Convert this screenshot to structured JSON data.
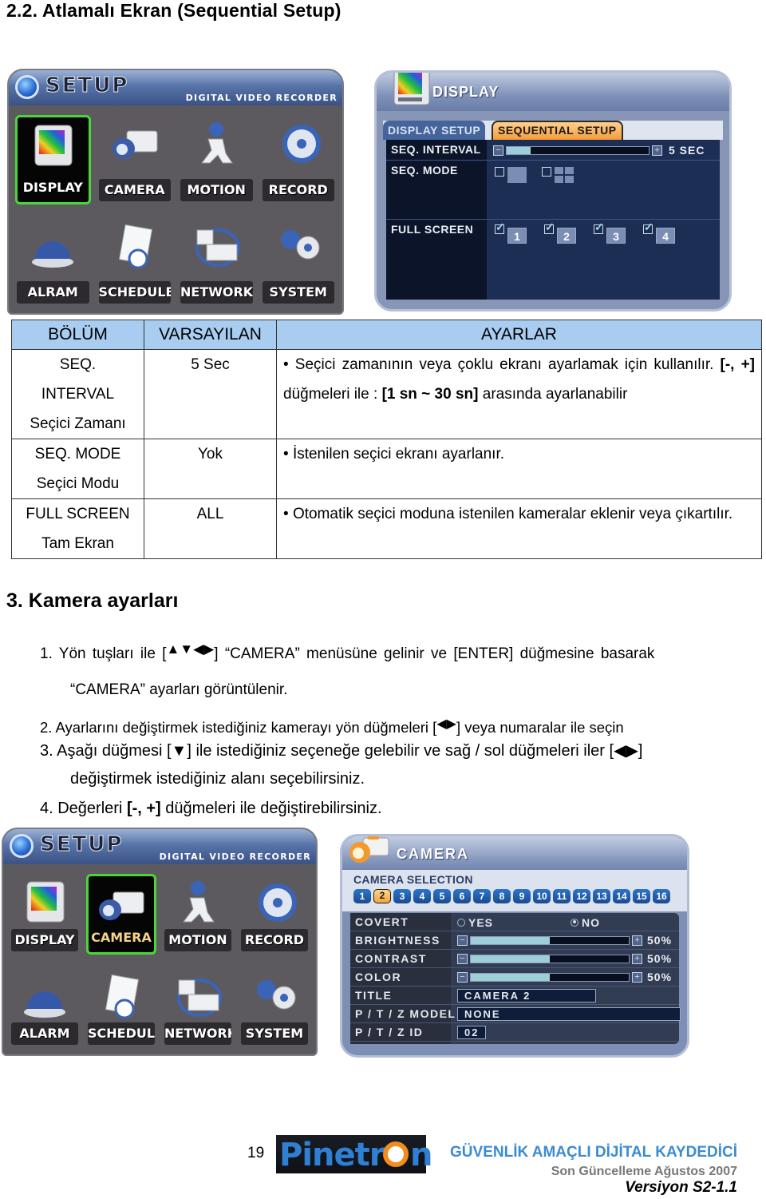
{
  "heading_section": "2.2. Atlamalı Ekran (Sequential Setup)",
  "setup_menu_1": {
    "title": "SETUP",
    "subtitle": "DIGITAL VIDEO RECORDER",
    "items": [
      {
        "label": "DISPLAY",
        "icon": "display-icon",
        "selected": true
      },
      {
        "label": "CAMERA",
        "icon": "camera-icon",
        "selected": false
      },
      {
        "label": "MOTION",
        "icon": "motion-icon",
        "selected": false
      },
      {
        "label": "RECORD",
        "icon": "record-icon",
        "selected": false
      },
      {
        "label": "ALRAM",
        "icon": "alarm-icon",
        "selected": false
      },
      {
        "label": "SCHEDULE",
        "icon": "schedule-icon",
        "selected": false
      },
      {
        "label": "NETWORK",
        "icon": "network-icon",
        "selected": false
      },
      {
        "label": "SYSTEM",
        "icon": "system-icon",
        "selected": false
      }
    ]
  },
  "display_panel": {
    "title": "DISPLAY",
    "tabs": [
      {
        "label": "DISPLAY SETUP",
        "active": false
      },
      {
        "label": "SEQUENTIAL SETUP",
        "active": true
      }
    ],
    "rows": {
      "seq_interval": {
        "label": "SEQ. INTERVAL",
        "value": "5 SEC",
        "fill_fraction": 0.17,
        "minus": "−",
        "plus": "+"
      },
      "seq_mode": {
        "label": "SEQ. MODE",
        "options": [
          {
            "type": "single",
            "checked": false
          },
          {
            "type": "quad",
            "checked": false
          }
        ]
      },
      "full_screen": {
        "label": "FULL SCREEN",
        "cameras": [
          {
            "num": "1",
            "checked": true
          },
          {
            "num": "2",
            "checked": true
          },
          {
            "num": "3",
            "checked": true
          },
          {
            "num": "4",
            "checked": true
          }
        ]
      }
    }
  },
  "table": {
    "headers": [
      "BÖLÜM",
      "VARSAYILAN",
      "AYARLAR"
    ],
    "rows": [
      {
        "section": [
          "SEQ.",
          "INTERVAL",
          "Seçici Zamanı"
        ],
        "default": "5 Sec",
        "desc_parts": [
          "Seçici zamanının veya çoklu ekranı ayarlamak için kullanılır. ",
          "[-, +]",
          " düğmeleri ile : ",
          "[1 sn ~ 30 sn]",
          " arasında ayarlanabilir"
        ]
      },
      {
        "section": [
          "SEQ. MODE",
          "Seçici Modu"
        ],
        "default": "Yok",
        "desc": "İstenilen seçici ekranı ayarlanır."
      },
      {
        "section": [
          "FULL SCREEN",
          "Tam Ekran"
        ],
        "default": "ALL",
        "desc": "Otomatik seçici moduna istenilen kameralar eklenir veya çıkartılır."
      }
    ]
  },
  "heading_camera": "3. Kamera ayarları",
  "steps": {
    "s1a_pre": "1.  Yön  tuşları  ile  [",
    "s1a_arrows": "▲▼◀▶",
    "s1a_post": "]  “CAMERA”  menüsüne  gelinir  ve  [ENTER]  düğmesine  basarak",
    "s1b": "“CAMERA” ayarları görüntülenir.",
    "s2_pre": "2. Ayarlarını değiştirmek istediğiniz kamerayı yön düğmeleri [",
    "s2_arrows": "◀▶",
    "s2_post": "] veya numaralar ile seçin",
    "s3a_pre": "3. Aşağı düğmesi [",
    "s3a_down": "▼",
    "s3a_mid": "] ile istediğiniz seçeneğe gelebilir ve sağ / sol düğmeleri iler [",
    "s3a_lr": "◀▶",
    "s3a_post": "]",
    "s3b": "değiştirmek istediğiniz alanı seçebilirsiniz.",
    "s4_pre": "4. Değerleri ",
    "s4_bold": "[-, +]",
    "s4_post": " düğmeleri ile değiştirebilirsiniz."
  },
  "setup_menu_2": {
    "title": "SETUP",
    "subtitle": "DIGITAL VIDEO RECORDER",
    "items": [
      {
        "label": "DISPLAY",
        "selected": false
      },
      {
        "label": "CAMERA",
        "selected": true
      },
      {
        "label": "MOTION",
        "selected": false
      },
      {
        "label": "RECORD",
        "selected": false
      },
      {
        "label": "ALARM",
        "selected": false
      },
      {
        "label": "SCHEDULE",
        "selected": false
      },
      {
        "label": "NETWORK",
        "selected": false
      },
      {
        "label": "SYSTEM",
        "selected": false
      }
    ]
  },
  "camera_panel": {
    "title": "CAMERA",
    "selection_label": "CAMERA SELECTION",
    "cameras": [
      "1",
      "2",
      "3",
      "4",
      "5",
      "6",
      "7",
      "8",
      "9",
      "10",
      "11",
      "12",
      "13",
      "14",
      "15",
      "16"
    ],
    "selected_camera": "2",
    "rows": {
      "covert": {
        "label": "COVERT",
        "yes": "YES",
        "no": "NO",
        "value": "NO"
      },
      "brightness": {
        "label": "BRIGHTNESS",
        "value": "50%",
        "fill_fraction": 0.5
      },
      "contrast": {
        "label": "CONTRAST",
        "value": "50%",
        "fill_fraction": 0.5
      },
      "color": {
        "label": "COLOR",
        "value": "50%",
        "fill_fraction": 0.5
      },
      "title": {
        "label": "TITLE",
        "value": "CAMERA  2"
      },
      "ptz_model": {
        "label": "P / T / Z  MODEL",
        "value": "NONE"
      },
      "ptz_id": {
        "label": "P / T / Z  ID",
        "value": "02"
      }
    }
  },
  "footer": {
    "page_number": "19",
    "logo": "Pinetr",
    "logo_tail": "n",
    "product": "GÜVENLİK AMAÇLI DİJİTAL KAYDEDİCİ",
    "updated": "Son Güncelleme Ağustos 2007",
    "version": "Versiyon S2-1.1"
  }
}
